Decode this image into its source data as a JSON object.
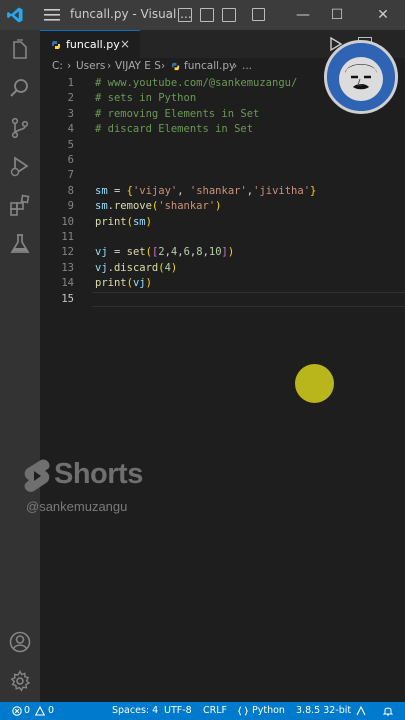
{
  "window": {
    "title": "funcall.py - Visual ...",
    "controls": {
      "minimize": "—",
      "maximize": "☐",
      "close": "✕"
    }
  },
  "tab": {
    "label": "funcall.py",
    "close": "×"
  },
  "breadcrumb": {
    "parts": [
      "C:",
      "Users",
      "VIJAY E S",
      "funcall.py",
      "..."
    ]
  },
  "editor": {
    "lines": [
      {
        "n": "1",
        "text": "# www.youtube.com/@sankemuzangu/"
      },
      {
        "n": "2",
        "text": "# sets in Python"
      },
      {
        "n": "3",
        "text": "# removing Elements in Set"
      },
      {
        "n": "4",
        "text": "# discard Elements in Set"
      },
      {
        "n": "5",
        "text": ""
      },
      {
        "n": "6",
        "text": ""
      },
      {
        "n": "7",
        "text": ""
      },
      {
        "n": "8",
        "text": "sm = {'vijay', 'shankar','jivitha'}"
      },
      {
        "n": "9",
        "text": "sm.remove('shankar')"
      },
      {
        "n": "10",
        "text": "print(sm)"
      },
      {
        "n": "11",
        "text": ""
      },
      {
        "n": "12",
        "text": "vj = set([2,4,6,8,10])"
      },
      {
        "n": "13",
        "text": "vj.discard(4)"
      },
      {
        "n": "14",
        "text": "print(vj)"
      },
      {
        "n": "15",
        "text": ""
      }
    ],
    "active_line": "15"
  },
  "watermark": {
    "brand": "Shorts",
    "handle": "@sankemuzangu"
  },
  "statusbar": {
    "errors": "0",
    "warnings": "0",
    "spaces": "Spaces: 4",
    "encoding": "UTF-8",
    "eol": "CRLF",
    "language": "Python",
    "interpreter": "3.8.5 32-bit"
  },
  "colors": {
    "accent": "#007acc",
    "titlebar": "#3c3c3c",
    "activitybar": "#333333",
    "editor_bg": "#1e1e1e",
    "comment": "#6a9955",
    "string": "#ce9178",
    "variable": "#9cdcfe",
    "function": "#dcdcaa",
    "number": "#b5cea8"
  },
  "icons": [
    "vscode-logo-icon",
    "menu-icon",
    "files-icon",
    "search-icon",
    "source-control-icon",
    "run-debug-icon",
    "extensions-icon",
    "testing-icon",
    "account-icon",
    "settings-gear-icon",
    "python-file-icon",
    "run-icon",
    "split-editor-icon"
  ]
}
